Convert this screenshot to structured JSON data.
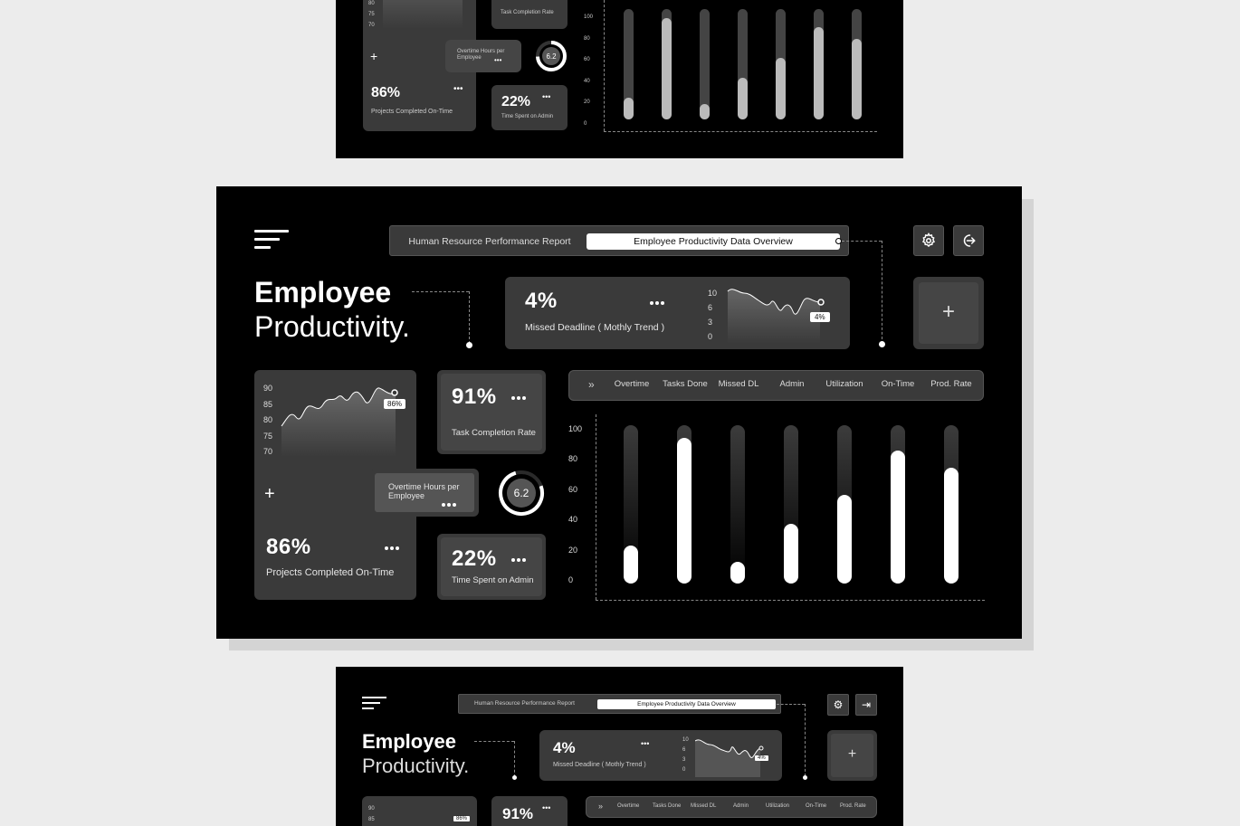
{
  "header": {
    "tabs": [
      {
        "label": "Human Resource Performance Report",
        "active": false
      },
      {
        "label": "Employee Productivity Data Overview",
        "active": true
      }
    ],
    "icons": [
      "menu-icon",
      "gear-icon",
      "logout-icon"
    ]
  },
  "title": {
    "line1": "Employee",
    "line2": "Productivity."
  },
  "missed_deadline": {
    "value": "4%",
    "label": "Missed Deadline ( Mothly Trend )",
    "y_ticks": [
      "10",
      "6",
      "3",
      "0"
    ],
    "badge": "4%"
  },
  "projects": {
    "value": "86%",
    "label": "Projects Completed On-Time",
    "y_ticks": [
      "90",
      "85",
      "80",
      "75",
      "70"
    ],
    "badge": "86%"
  },
  "task_completion": {
    "value": "91%",
    "label": "Task Completion Rate"
  },
  "overtime": {
    "line1": "Overtime Hours per",
    "line2": "Employee",
    "gauge_value": "6.2"
  },
  "admin_time": {
    "value": "22%",
    "label": "Time Spent on Admin"
  },
  "bar_chart": {
    "columns": [
      "Overtime",
      "Tasks Done",
      "Missed DL",
      "Admin",
      "Utilization",
      "On-Time",
      "Prod. Rate"
    ],
    "y_ticks": [
      "100",
      "80",
      "60",
      "40",
      "20",
      "0"
    ],
    "values": [
      24,
      92,
      14,
      38,
      56,
      84,
      73
    ]
  },
  "top_preview": {
    "y_ticks_left": [
      "80",
      "75",
      "70"
    ],
    "task_label": "Task Completion Rate",
    "overtime_line1": "Overtime Hours per",
    "overtime_line2": "Employee",
    "gauge_value": "6.2",
    "projects_value": "86%",
    "projects_label": "Projects Completed On-Time",
    "admin_value": "22%",
    "admin_label": "Time Spent on Admin",
    "y_ticks": [
      "100",
      "80",
      "60",
      "40",
      "20",
      "0"
    ],
    "values": [
      20,
      92,
      14,
      38,
      56,
      84,
      73
    ]
  },
  "bottom_preview": {
    "tab1": "Human Resource Performance Report",
    "tab2": "Employee Productivity Data Overview",
    "title1": "Employee",
    "title2": "Productivity.",
    "md_value": "4%",
    "md_label": "Missed Deadline ( Mothly Trend )",
    "md_ticks": [
      "10",
      "6",
      "3",
      "0"
    ],
    "md_badge": "4%",
    "y_ticks": [
      "90",
      "85"
    ],
    "badge": "86%",
    "task_value": "91%",
    "columns": [
      "Overtime",
      "Tasks Done",
      "Missed DL",
      "Admin",
      "Utilization",
      "On-Time",
      "Prod. Rate"
    ]
  }
}
